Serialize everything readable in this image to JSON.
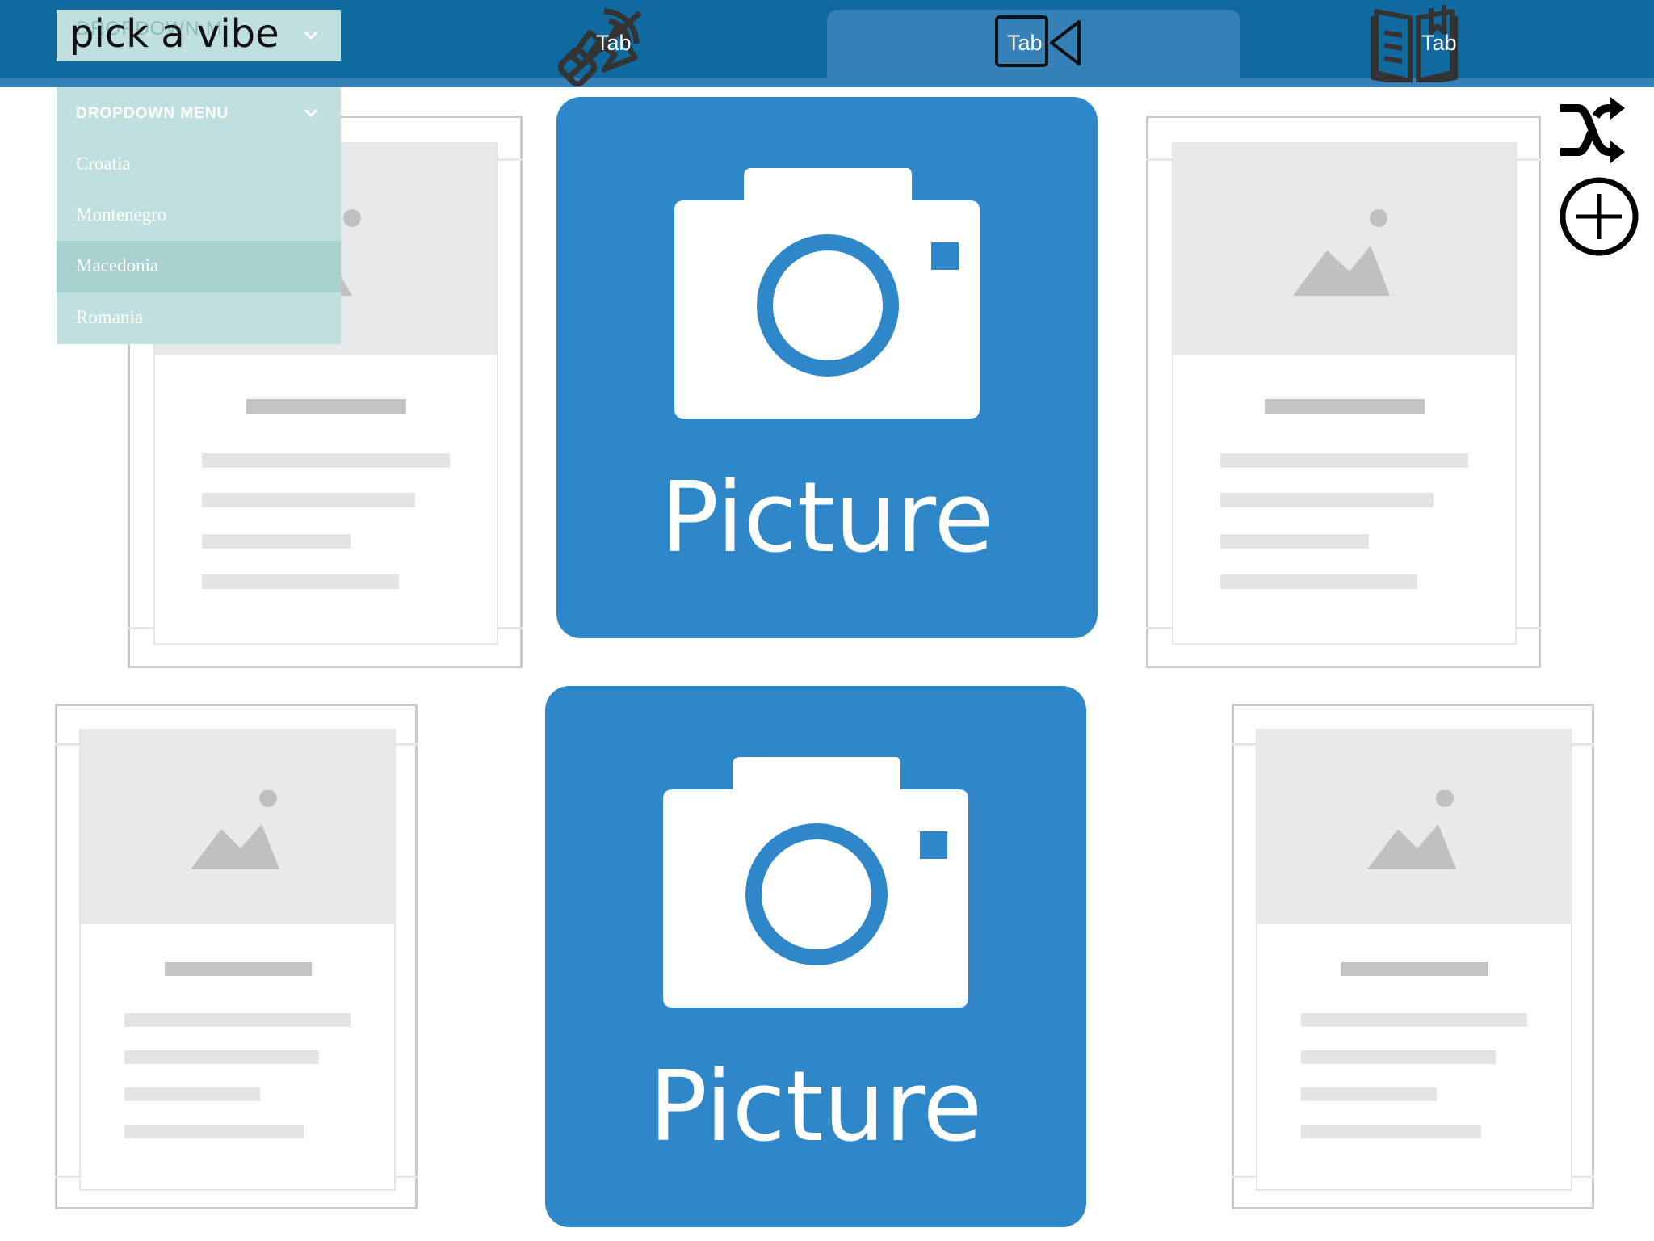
{
  "topbar": {
    "tabs": [
      {
        "label": "Tab",
        "icon": "mute-speaker-icon"
      },
      {
        "label": "Tab",
        "icon": "video-camera-icon",
        "active": true
      },
      {
        "label": "Tab",
        "icon": "open-book-icon"
      }
    ]
  },
  "dropdown": {
    "value": "pick a vibe",
    "faint_label": "DROPDOWN M",
    "menu_header": "DROPDOWN MENU",
    "items": [
      {
        "label": "Croatia"
      },
      {
        "label": "Montenegro"
      },
      {
        "label": "Macedonia",
        "selected": true
      },
      {
        "label": "Romania"
      }
    ]
  },
  "side_actions": {
    "shuffle_icon": "shuffle-icon",
    "add_icon": "add-circle-icon"
  },
  "picture_tiles": [
    {
      "label": "Picture",
      "icon": "camera-icon"
    },
    {
      "label": "Picture",
      "icon": "camera-icon"
    }
  ],
  "cards": [
    {
      "icon": "image-placeholder-icon"
    },
    {
      "icon": "image-placeholder-icon"
    },
    {
      "icon": "image-placeholder-icon"
    },
    {
      "icon": "image-placeholder-icon"
    }
  ],
  "colors": {
    "topbar": "#0f6aa0",
    "active_tab": "#3580b7",
    "dropdown_bg": "#c0e0df",
    "dropdown_selected": "#a9d1d0",
    "picture_tile": "#2e87c8"
  }
}
